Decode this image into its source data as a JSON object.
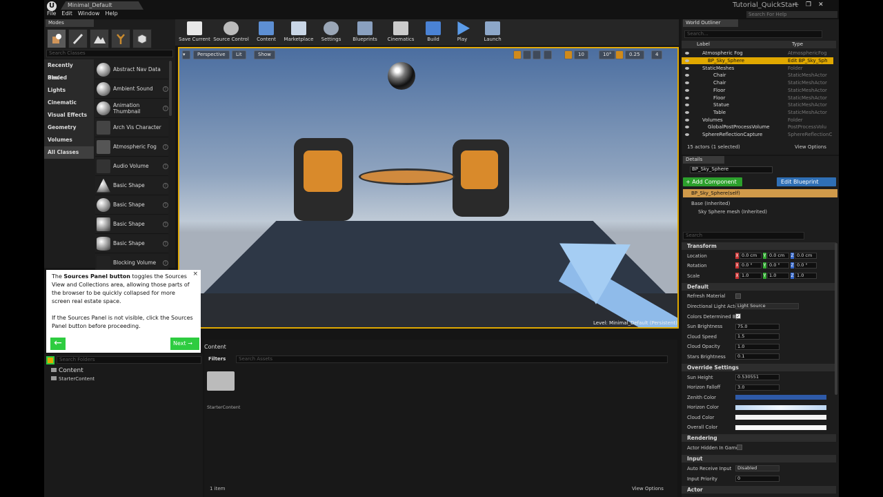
{
  "window": {
    "doc_tab": "Minimal_Default",
    "menu": [
      "File",
      "Edit",
      "Window",
      "Help"
    ],
    "project_title": "Tutorial_QuickStart",
    "search_help_placeholder": "Search For Help"
  },
  "modes": {
    "tab": "Modes",
    "search_placeholder": "Search Classes",
    "categories": [
      "Recently Placed",
      "Basic",
      "Lights",
      "Cinematic",
      "Visual Effects",
      "Geometry",
      "Volumes",
      "All Classes"
    ],
    "selected_category": "All Classes",
    "classes": [
      "Abstract Nav Data",
      "Ambient Sound",
      "Animation Thumbnail",
      "Arch Vis Character",
      "Atmospheric Fog",
      "Audio Volume",
      "Basic Shape",
      "Basic Shape",
      "Basic Shape",
      "Basic Shape",
      "Blocking Volume"
    ]
  },
  "toolbar": {
    "buttons": [
      "Save Current",
      "Source Control",
      "Content",
      "Marketplace",
      "Settings",
      "Blueprints",
      "Cinematics",
      "Build",
      "Play",
      "Launch"
    ]
  },
  "viewport": {
    "perspective": "Perspective",
    "lit": "Lit",
    "show": "Show",
    "grid_snap": "10",
    "rot_snap": "10°",
    "scale_snap": "0.25",
    "cam_speed": "4",
    "level_text": "Level:  Minimal_Default (Persistent)"
  },
  "tooltip": {
    "text1_pre": "The ",
    "text1_bold": "Sources Panel button",
    "text1_post": " toggles the Sources View and Collections area, allowing those parts of the browser to be quickly collapsed for more screen real estate space.",
    "text2": "If the Sources Panel is not visible, click the Sources Panel button before proceeding.",
    "next_label": "Next"
  },
  "content_browser": {
    "folders_placeholder": "Search Folders",
    "tree": [
      "Content",
      "StarterContent"
    ],
    "path": "Content",
    "filters": "Filters",
    "assets_placeholder": "Search Assets",
    "asset_name": "StarterContent",
    "item_count": "1 item",
    "view_options": "View Options"
  },
  "outliner": {
    "tab": "World Outliner",
    "search_placeholder": "Search...",
    "col_label": "Label",
    "col_type": "Type",
    "rows": [
      {
        "label": "Atmospheric Fog",
        "type": "AtmosphericFog"
      },
      {
        "label": "BP_Sky_Sphere",
        "type": "Edit BP_Sky_Sph"
      },
      {
        "label": "StaticMeshes",
        "type": "Folder"
      },
      {
        "label": "Chair",
        "type": "StaticMeshActor"
      },
      {
        "label": "Chair",
        "type": "StaticMeshActor"
      },
      {
        "label": "Floor",
        "type": "StaticMeshActor"
      },
      {
        "label": "Floor",
        "type": "StaticMeshActor"
      },
      {
        "label": "Statue",
        "type": "StaticMeshActor"
      },
      {
        "label": "Table",
        "type": "StaticMeshActor"
      },
      {
        "label": "Volumes",
        "type": "Folder"
      },
      {
        "label": "GlobalPostProcessVolume",
        "type": "PostProcessVolu"
      },
      {
        "label": "SphereReflectionCapture",
        "type": "SphereReflectionC"
      }
    ],
    "selected_index": 1,
    "status": "15 actors (1 selected)",
    "view_options": "View Options"
  },
  "details": {
    "tab": "Details",
    "object_name": "BP_Sky_Sphere",
    "add_component": "+ Add Component",
    "edit_blueprint": "Edit Blueprint",
    "self_item": "BP_Sky_Sphere(self)",
    "base": "Base (Inherited)",
    "mesh": "Sky Sphere mesh (Inherited)",
    "search_placeholder": "Search",
    "transform": {
      "title": "Transform",
      "location_label": "Location",
      "location": [
        "0.0 cm",
        "0.0 cm",
        "0.0 cm"
      ],
      "rotation_label": "Rotation",
      "rotation": [
        "0.0 °",
        "0.0 °",
        "0.0 °"
      ],
      "scale_label": "Scale",
      "scale": [
        "1.0",
        "1.0",
        "1.0"
      ]
    },
    "default": {
      "title": "Default",
      "refresh_material": "Refresh Material",
      "directional_light": "Directional Light Acto",
      "directional_light_value": "Light Source",
      "colors_determined": "Colors Determined By",
      "sun_brightness_label": "Sun Brightness",
      "sun_brightness": "75.0",
      "cloud_speed_label": "Cloud Speed",
      "cloud_speed": "1.5",
      "cloud_opacity_label": "Cloud Opacity",
      "cloud_opacity": "1.0",
      "stars_brightness_label": "Stars Brightness",
      "stars_brightness": "0.1"
    },
    "override": {
      "title": "Override Settings",
      "sun_height_label": "Sun Height",
      "sun_height": "0.530551",
      "horizon_falloff_label": "Horizon Falloff",
      "horizon_falloff": "3.0",
      "zenith_label": "Zenith Color",
      "horizon_label": "Horizon Color",
      "cloud_label": "Cloud Color",
      "overall_label": "Overall Color"
    },
    "rendering": {
      "title": "Rendering",
      "hidden_label": "Actor Hidden In Game"
    },
    "input": {
      "title": "Input",
      "auto_receive_label": "Auto Receive Input",
      "auto_receive": "Disabled",
      "priority_label": "Input Priority",
      "priority": "0"
    },
    "actor_title": "Actor"
  },
  "colors": {
    "accent": "#e0a800",
    "green": "#2ecc40",
    "zenith": "#2e5aa8",
    "horizon": "#cfe3f7"
  }
}
